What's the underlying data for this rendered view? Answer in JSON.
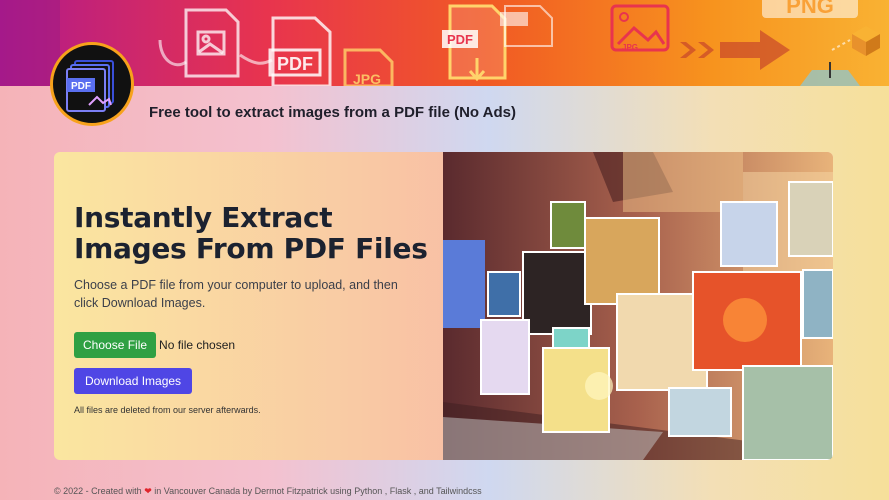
{
  "banner": {
    "pdf_label": "PDF",
    "jpg_label": "JPG",
    "png_label": "PNG"
  },
  "logo": {
    "label": "PDF",
    "ring_color": "#f7a21b"
  },
  "header": {
    "tagline": "Free tool to extract images from a PDF file (No Ads)"
  },
  "hero": {
    "headline": "Instantly Extract Images From PDF Files",
    "description": "Choose a PDF file from your computer to upload, and then click Download Images.",
    "choose_file_label": "Choose File",
    "no_file_text": "No file chosen",
    "download_label": "Download Images",
    "note": "All files are deleted from our server afterwards."
  },
  "footer": {
    "prefix": "© 2022 - Created with",
    "heart": "❤",
    "suffix": "in Vancouver Canada by Dermot Fitzpatrick using Python , Flask , and Tailwindcss"
  },
  "colors": {
    "choose_button": "#2fa043",
    "download_button": "#4f46e5",
    "logo_ring": "#f7a21b"
  }
}
